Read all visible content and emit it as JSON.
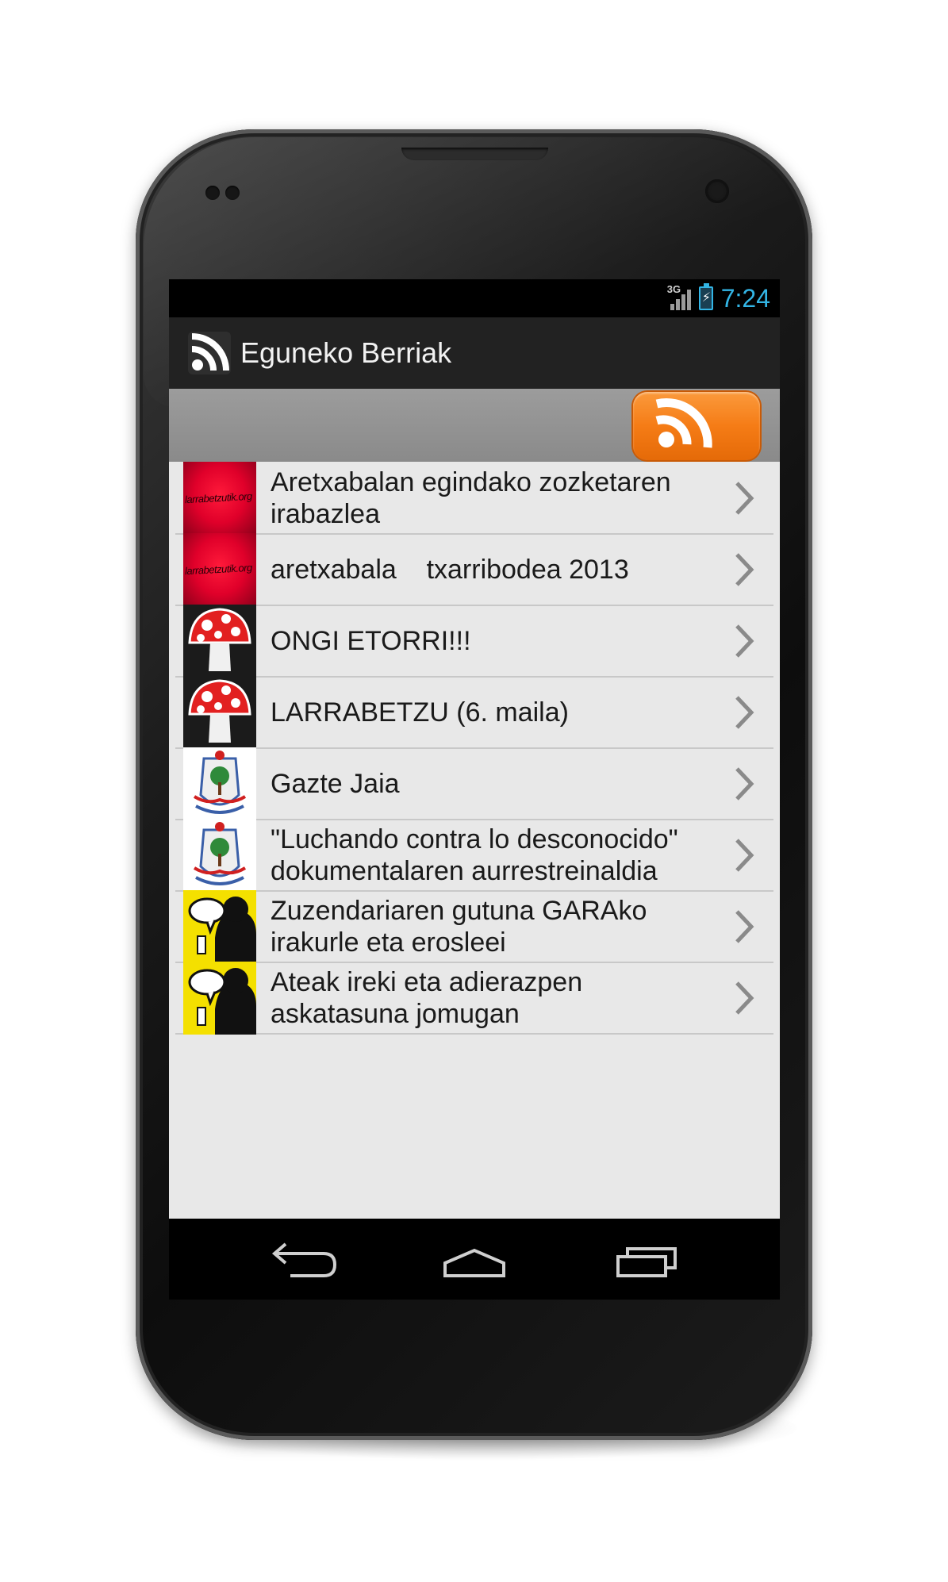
{
  "status_bar": {
    "network": "3G",
    "time": "7:24"
  },
  "action_bar": {
    "title": "Eguneko Berriak",
    "icon": "rss-feed-icon"
  },
  "header": {
    "rss_button_icon": "rss-feed-icon",
    "rss_button_color": "#f57c16"
  },
  "items": [
    {
      "title": "Aretxabalan egindako zozketaren irabazlea",
      "thumb_text": "larrabetzutik.org"
    },
    {
      "title": "aretxabala    txarribodea 2013",
      "thumb_text": "larrabetzutik.org"
    },
    {
      "title": "ONGI ETORRI!!!",
      "thumb": "mushroom-icon"
    },
    {
      "title": "LARRABETZU (6. maila)",
      "thumb": "mushroom-icon"
    },
    {
      "title": "Gazte Jaia",
      "thumb": "coat-of-arms-icon"
    },
    {
      "title": "\"Luchando contra lo desconocido\" dokumentalaren aurrestreinaldia",
      "thumb": "coat-of-arms-icon"
    },
    {
      "title": "Zuzendariaren gutuna GARAko irakurle eta erosleei",
      "thumb": "speech-bubble-silhouette-icon"
    },
    {
      "title": "Ateak ireki eta adierazpen askatasuna jomugan",
      "thumb": "speech-bubble-silhouette-icon"
    }
  ],
  "nav_bar": {
    "back": "back-icon",
    "home": "home-icon",
    "recents": "recent-apps-icon"
  },
  "colors": {
    "status_accent": "#33b5e5",
    "action_bar": "#222222",
    "list_bg": "#e8e8e8"
  }
}
